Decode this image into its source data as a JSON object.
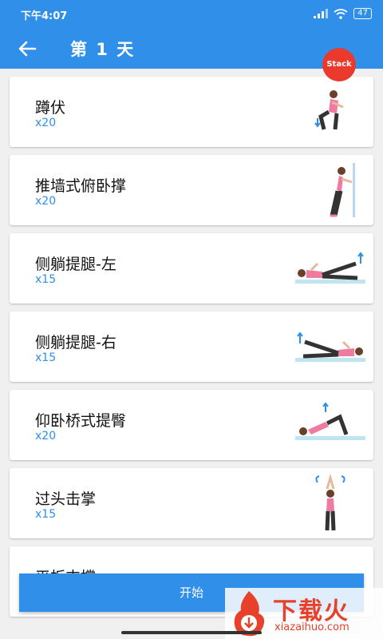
{
  "status_bar": {
    "time": "下午4:07",
    "battery": "47"
  },
  "app_bar": {
    "title": "第 1 天"
  },
  "exercises": [
    {
      "name": "蹲伏",
      "count": "x20",
      "icon": "squat-illustration"
    },
    {
      "name": "推墙式俯卧撑",
      "count": "x20",
      "icon": "wall-pushup-illustration"
    },
    {
      "name": "侧躺提腿-左",
      "count": "x15",
      "icon": "side-leg-raise-left-illustration"
    },
    {
      "name": "侧躺提腿-右",
      "count": "x15",
      "icon": "side-leg-raise-right-illustration"
    },
    {
      "name": "仰卧桥式提臀",
      "count": "x20",
      "icon": "glute-bridge-illustration"
    },
    {
      "name": "过头击掌",
      "count": "x15",
      "icon": "overhead-clap-illustration"
    },
    {
      "name": "平板支撑",
      "count": "",
      "icon": "plank-illustration"
    }
  ],
  "stack_badge": "Stack",
  "start_button": "开始",
  "watermark": {
    "title": "下载火",
    "subtitle": "xiazaihuo.com"
  },
  "colors": {
    "primary": "#2f8fe9",
    "accent": "#e8412b",
    "background": "#f0f0f0"
  }
}
